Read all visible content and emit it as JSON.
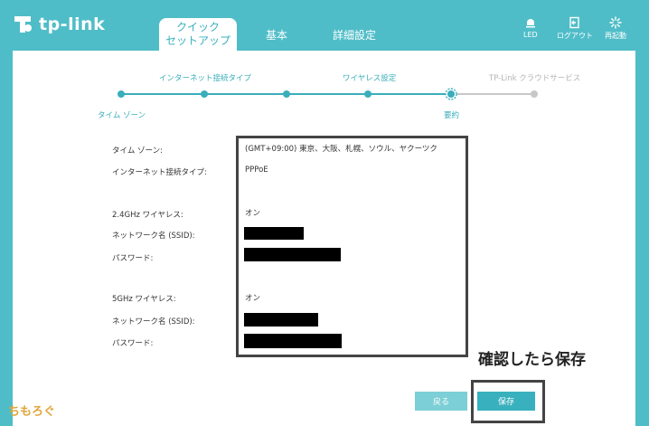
{
  "brand": {
    "name": "tp-link"
  },
  "nav": {
    "tabs": [
      {
        "label_line1": "クイック",
        "label_line2": "セットアップ"
      },
      {
        "label": "基本"
      },
      {
        "label": "詳細設定"
      }
    ],
    "actions": [
      {
        "label": "LED",
        "icon": "led-bulb-icon"
      },
      {
        "label": "ログアウト",
        "icon": "logout-icon"
      },
      {
        "label": "再起動",
        "icon": "reboot-icon"
      }
    ]
  },
  "steps": {
    "top_labels": [
      "インターネット接続タイプ",
      "ワイヤレス設定",
      "TP-Link クラウドサービス"
    ],
    "bottom_labels": [
      "タイム ゾーン",
      "要約"
    ],
    "current_step": 5,
    "total_steps": 6,
    "colors": {
      "done": "#3aaebb",
      "pending": "#c8c8c8"
    }
  },
  "summary": {
    "rows": [
      {
        "label": "タイム ゾーン:",
        "value": "(GMT+09:00) 東京、大阪、札幌、ソウル、ヤクーツク"
      },
      {
        "label": "インターネット接続タイプ:",
        "value": "PPPoE"
      },
      {
        "label": "2.4GHz ワイヤレス:",
        "value": "オン"
      },
      {
        "label": "ネットワーク名 (SSID):",
        "value": ""
      },
      {
        "label": "パスワード:",
        "value": ""
      },
      {
        "label": "5GHz ワイヤレス:",
        "value": "オン"
      },
      {
        "label": "ネットワーク名 (SSID):",
        "value": ""
      },
      {
        "label": "パスワード:",
        "value": ""
      }
    ]
  },
  "annotation": "確認したら保存",
  "buttons": {
    "back": "戻る",
    "save": "保存"
  },
  "watermark": "ちもろぐ",
  "colors": {
    "accent": "#4fbdc8",
    "button": "#39b0bd",
    "button_light": "#7ccfd6"
  }
}
